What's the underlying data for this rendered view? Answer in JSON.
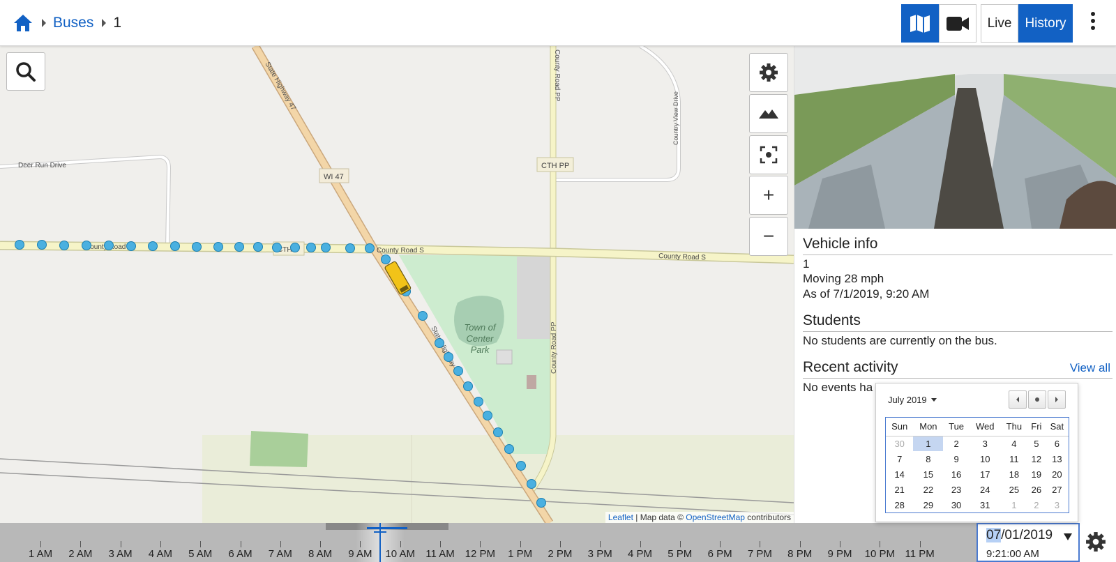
{
  "header": {
    "breadcrumb": {
      "home_icon": "home-icon",
      "parent": "Buses",
      "current": "1"
    },
    "view_buttons": {
      "map_icon": "map-icon",
      "camera_icon": "video-camera-icon"
    },
    "mode": {
      "live": "Live",
      "history": "History",
      "active": "History"
    },
    "menu_icon": "kebab-menu-icon"
  },
  "map": {
    "controls": [
      "search-icon",
      "gear-icon",
      "terrain-icon",
      "recenter-icon",
      "zoom-in-icon",
      "zoom-out-icon"
    ],
    "zoom_in_label": "+",
    "zoom_out_label": "−",
    "labels": {
      "deer_run": "Deer Run Drive",
      "hwy47": "State Highway 47",
      "wi47": "WI 47",
      "road_pp": "County Road PP",
      "cth_pp": "CTH PP",
      "country_view": "Country View Drive",
      "county_s": "County Road S",
      "cth_s": "CTH S",
      "park_1": "Town of",
      "park_2": "Center",
      "park_3": "Park",
      "hwy47_low": "State Highway 47"
    },
    "attribution": {
      "leaflet": "Leaflet",
      "mid": " | Map data © ",
      "osm": "OpenStreetMap",
      "end": " contributors"
    }
  },
  "vehicle_info": {
    "heading": "Vehicle info",
    "name": "1",
    "status": "Moving 28 mph",
    "as_of": "As of 7/1/2019, 9:20 AM"
  },
  "students": {
    "heading": "Students",
    "text": "No students are currently on the bus."
  },
  "recent_activity": {
    "heading": "Recent activity",
    "view_all": "View all",
    "text": "No events ha"
  },
  "calendar": {
    "month_label": "July 2019",
    "weekdays": [
      "Sun",
      "Mon",
      "Tue",
      "Wed",
      "Thu",
      "Fri",
      "Sat"
    ],
    "weeks": [
      [
        "30",
        "1",
        "2",
        "3",
        "4",
        "5",
        "6"
      ],
      [
        "7",
        "8",
        "9",
        "10",
        "11",
        "12",
        "13"
      ],
      [
        "14",
        "15",
        "16",
        "17",
        "18",
        "19",
        "20"
      ],
      [
        "21",
        "22",
        "23",
        "24",
        "25",
        "26",
        "27"
      ],
      [
        "28",
        "29",
        "30",
        "31",
        "1",
        "2",
        "3"
      ]
    ],
    "selected": "1"
  },
  "timeline": {
    "hours": [
      "1 AM",
      "2 AM",
      "3 AM",
      "4 AM",
      "5 AM",
      "6 AM",
      "7 AM",
      "8 AM",
      "9 AM",
      "10 AM",
      "11 AM",
      "12 PM",
      "1 PM",
      "2 PM",
      "3 PM",
      "4 PM",
      "5 PM",
      "6 PM",
      "7 PM",
      "8 PM",
      "9 PM",
      "10 PM",
      "11 PM"
    ]
  },
  "datetime": {
    "date_month": "07",
    "date_rest": "/01/2019",
    "time": "9:21:00 AM"
  },
  "colors": {
    "accent": "#1261c4",
    "road": "#f3d6a8",
    "minor_road": "#f4f1c2",
    "park": "#cdeccf",
    "track_point": "#4ab0e0",
    "bus": "#f2c318"
  }
}
